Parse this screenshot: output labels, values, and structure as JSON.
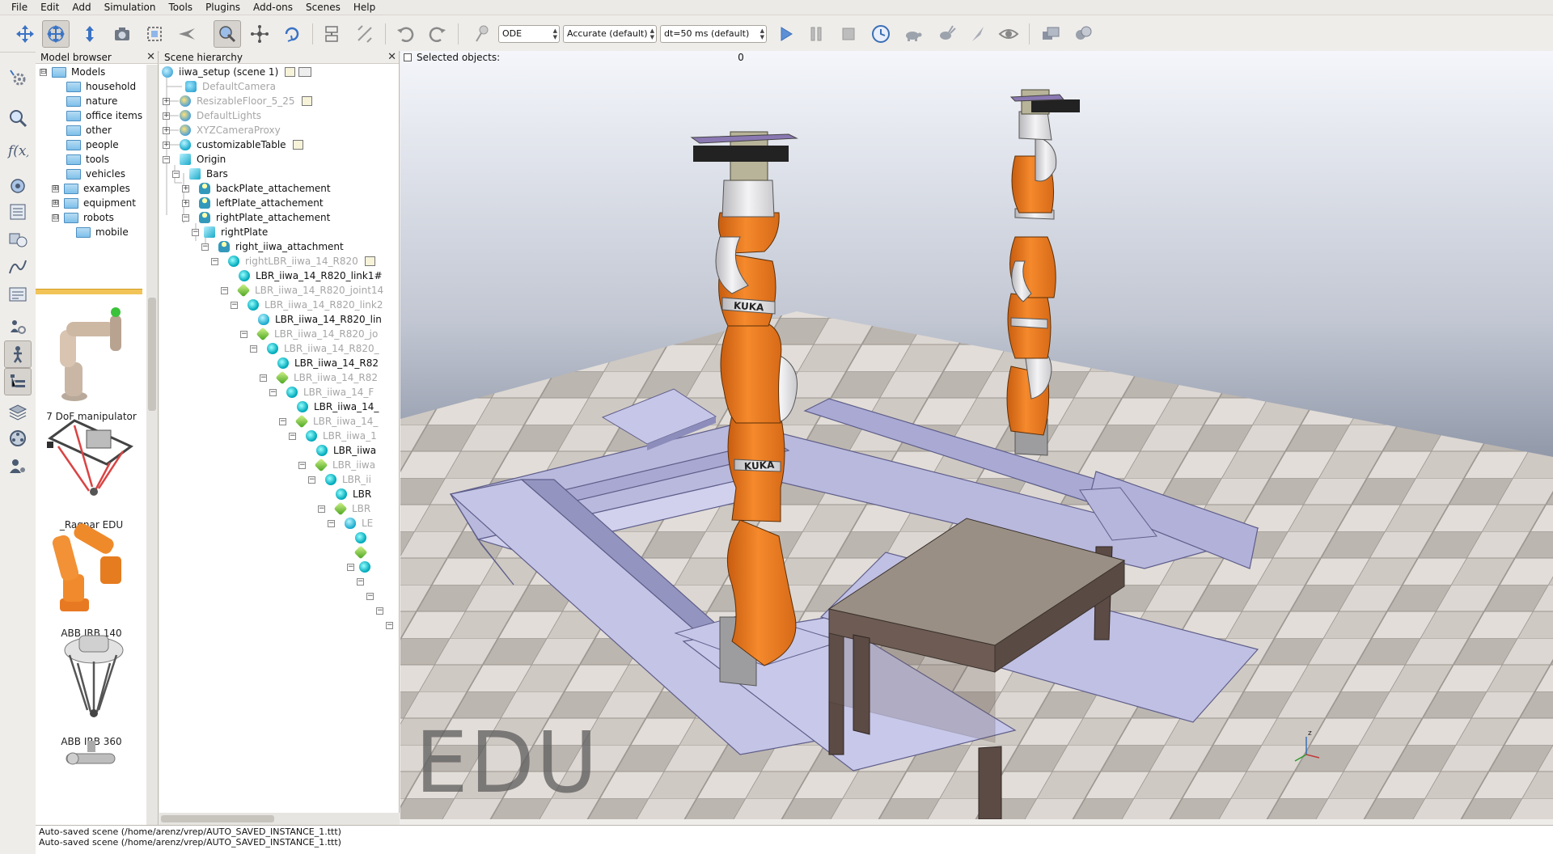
{
  "menu": [
    "File",
    "Edit",
    "Add",
    "Simulation",
    "Tools",
    "Plugins",
    "Add-ons",
    "Scenes",
    "Help"
  ],
  "toolbar": {
    "engine": "ODE",
    "accuracy": "Accurate (default)",
    "timestep": "dt=50 ms (default)"
  },
  "model_browser": {
    "title": "Model browser",
    "tree": [
      {
        "label": "Models",
        "expander": "⊟"
      },
      {
        "label": "household"
      },
      {
        "label": "nature"
      },
      {
        "label": "office items"
      },
      {
        "label": "other"
      },
      {
        "label": "people"
      },
      {
        "label": "tools"
      },
      {
        "label": "vehicles"
      },
      {
        "label": "examples",
        "expander": "⊞"
      },
      {
        "label": "equipment",
        "expander": "⊞"
      },
      {
        "label": "robots",
        "expander": "⊟"
      },
      {
        "label": "mobile"
      }
    ],
    "models": [
      {
        "label": "7 DoF manipulator"
      },
      {
        "label": "_Ragnar EDU"
      },
      {
        "label": "ABB IRB 140"
      },
      {
        "label": "ABB IRB 360"
      }
    ]
  },
  "scene_hierarchy": {
    "title": "Scene hierarchy",
    "root": "iiwa_setup (scene 1)",
    "nodes": [
      {
        "label": "DefaultCamera"
      },
      {
        "label": "ResizableFloor_5_25"
      },
      {
        "label": "DefaultLights"
      },
      {
        "label": "XYZCameraProxy"
      },
      {
        "label": "customizableTable"
      },
      {
        "label": "Origin"
      },
      {
        "label": "Bars"
      },
      {
        "label": "backPlate_attachement"
      },
      {
        "label": "leftPlate_attachement"
      },
      {
        "label": "rightPlate_attachement"
      },
      {
        "label": "rightPlate"
      },
      {
        "label": "right_iiwa_attachment"
      },
      {
        "label": "rightLBR_iiwa_14_R820"
      },
      {
        "label": "LBR_iiwa_14_R820_link1#"
      },
      {
        "label": "LBR_iiwa_14_R820_joint14"
      },
      {
        "label": "LBR_iiwa_14_R820_link2"
      },
      {
        "label": "LBR_iiwa_14_R820_lin"
      },
      {
        "label": "LBR_iiwa_14_R820_jo"
      },
      {
        "label": "LBR_iiwa_14_R820_"
      },
      {
        "label": "LBR_iiwa_14_R82"
      },
      {
        "label": "LBR_iiwa_14_R82"
      },
      {
        "label": "LBR_iiwa_14_F"
      },
      {
        "label": "LBR_iiwa_14_"
      },
      {
        "label": "LBR_iiwa_14_"
      },
      {
        "label": "LBR_iiwa_1"
      },
      {
        "label": "LBR_iiwa"
      },
      {
        "label": "LBR_iiwa"
      },
      {
        "label": "LBR_ii"
      },
      {
        "label": "LBR"
      },
      {
        "label": "LBR"
      },
      {
        "label": "LE"
      }
    ]
  },
  "viewport": {
    "selected_label": "Selected objects:",
    "selected_count": "0",
    "watermark": "EDU",
    "robot_band_text": "KUKA",
    "axis_z": "z"
  },
  "console": {
    "lines": [
      "Auto-saved scene (/home/arenz/vrep/AUTO_SAVED_INSTANCE_1.ttt)",
      "Auto-saved scene (/home/arenz/vrep/AUTO_SAVED_INSTANCE_1.ttt)"
    ]
  },
  "colors": {
    "robot_orange": "#f07d22",
    "robot_white": "#e9e9eb",
    "bars": "#b8b8dd",
    "table_top": "#9a8f84",
    "table_legs": "#5c4b45",
    "floor_light": "#d8d2cc",
    "floor_dark": "#a9a39d"
  },
  "icons": {
    "toolbar": [
      "camera-pan-icon",
      "camera-rotate-icon",
      "camera-shift-icon",
      "camera-opening-icon",
      "fit-to-view-icon",
      "camera-fly-icon",
      "object-select-icon",
      "object-move-icon",
      "object-rotate-icon",
      "assemble-icon",
      "transfer-dna-icon",
      "undo-icon",
      "redo-icon",
      "dynamics-icon",
      "play-icon",
      "pause-icon",
      "stop-icon",
      "realtime-icon",
      "slower-icon",
      "faster-icon",
      "thread-icon",
      "visualization-icon",
      "page-selector-icon",
      "scene-selector-icon"
    ],
    "left": [
      "settings-icon",
      "search-icon",
      "function-icon",
      "scene-objects-icon",
      "calculation-icon",
      "collision-icon",
      "path-icon",
      "properties-icon",
      "user-settings-icon",
      "model-browser-icon",
      "scene-hierarchy-icon",
      "layers-icon",
      "video-recorder-icon",
      "user-icon"
    ]
  }
}
